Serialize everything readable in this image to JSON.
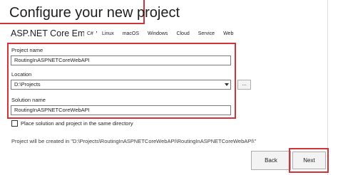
{
  "header": {
    "title": "Configure your new project",
    "template_name": "ASP.NET Core Empty",
    "tags": [
      "C#",
      "Linux",
      "macOS",
      "Windows",
      "Cloud",
      "Service",
      "Web"
    ]
  },
  "form": {
    "project_name_label": "Project name",
    "project_name_value": "RoutingInASPNETCoreWebAPI",
    "location_label": "Location",
    "location_value": "D:\\Projects",
    "browse_label": "...",
    "solution_name_label": "Solution name",
    "solution_name_value": "RoutingInASPNETCoreWebAPI",
    "same_directory_label": "Place solution and project in the same directory",
    "same_directory_checked": false
  },
  "info": {
    "created_path_text": "Project will be created in \"D:\\Projects\\RoutingInASPNETCoreWebAPI\\RoutingInASPNETCoreWebAPI\\\""
  },
  "footer": {
    "back_label": "Back",
    "next_label": "Next"
  },
  "colors": {
    "highlight": "#d13438"
  }
}
